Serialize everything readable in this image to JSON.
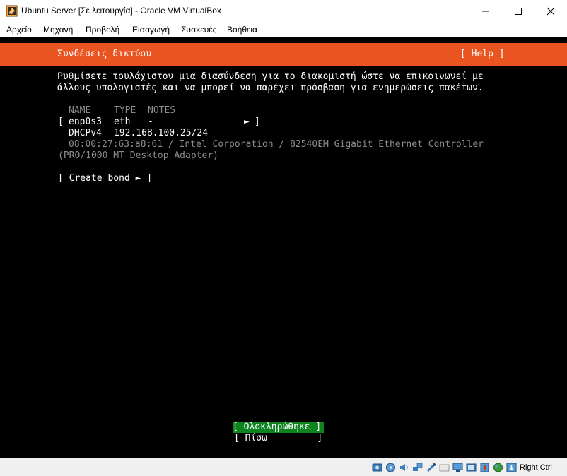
{
  "window": {
    "title": "Ubuntu Server [Σε λειτουργία] - Oracle VM VirtualBox"
  },
  "menu": {
    "items": [
      "Αρχείο",
      "Μηχανή",
      "Προβολή",
      "Εισαγωγή",
      "Συσκευές",
      "Βοήθεια"
    ]
  },
  "installer": {
    "header_title": "Συνδέσεις δικτύου",
    "help_label": "[ Help ]",
    "intro_line1": "Ρυθμίσετε τουλάχιστον μια διασύνδεση για το διακομιστή ώστε να επικοινωνεί με",
    "intro_line2": "άλλους υπολογιστές και να μπορεί να παρέχει πρόσβαση για ενημερώσεις πακέτων.",
    "table": {
      "columns": [
        "NAME",
        "TYPE",
        "NOTES"
      ],
      "interface": {
        "open_bracket": "[",
        "name": "enp0s3",
        "type": "eth",
        "notes": "-",
        "menu_arrow": "►",
        "close_bracket": "]",
        "address_method": "DHCPv4",
        "address": "192.168.100.25/24",
        "hw_line1": "08:00:27:63:a8:61 / Intel Corporation / 82540EM Gigabit Ethernet Controller",
        "hw_line2": "(PRO/1000 MT Desktop Adapter)"
      }
    },
    "create_bond_label": "[ Create bond ► ]",
    "done_button": "[ Ολοκληρώθηκε ]",
    "back_button": "[ Πίσω         ]"
  },
  "statusbar": {
    "icons": [
      "hard-disk-icon",
      "optical-disk-icon",
      "audio-icon",
      "network-icon",
      "usb-icon",
      "shared-folders-icon",
      "display-icon",
      "recording-icon",
      "virtualization-icon",
      "mouse-integration-icon",
      "keyboard-icon"
    ],
    "host_key": "Right Ctrl"
  },
  "colors": {
    "header": "#e95420",
    "done_button": "#0e8420",
    "screen_bg": "#000000"
  }
}
